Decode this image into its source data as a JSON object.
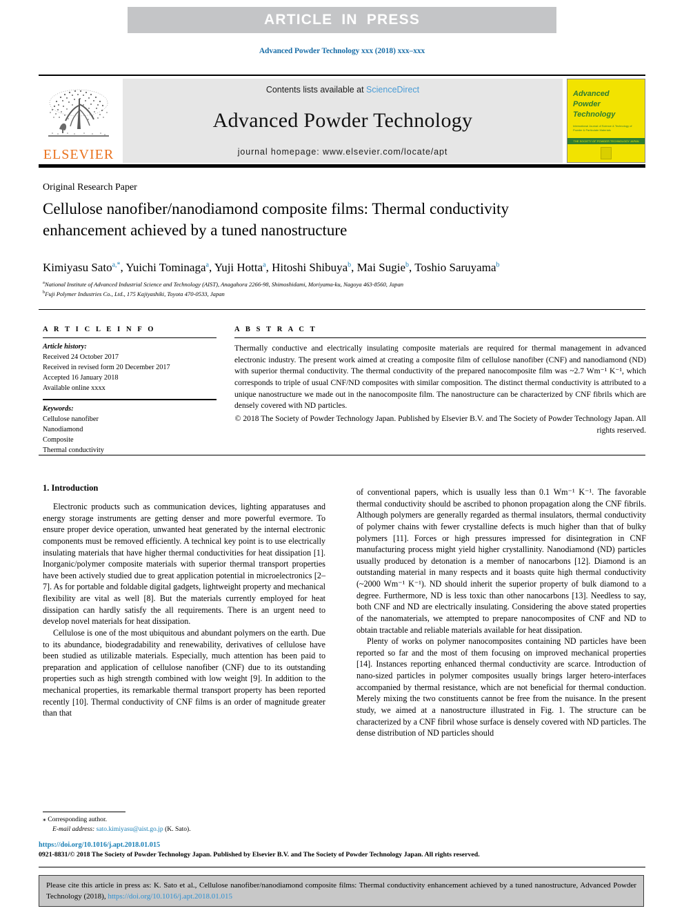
{
  "banner": {
    "text": "ARTICLE  IN  PRESS",
    "bg_color": "#c4c5c7",
    "text_color": "#ffffff"
  },
  "running_head": "Advanced Powder Technology xxx (2018) xxx–xxx",
  "masthead": {
    "publisher_logo_label": "ELSEVIER",
    "contents_prefix": "Contents lists available at ",
    "contents_link": "ScienceDirect",
    "journal_name": "Advanced Powder Technology",
    "homepage": "journal homepage: www.elsevier.com/locate/apt",
    "cover": {
      "line1": "Advanced",
      "line2": "Powder",
      "line3": "Technology",
      "subtitle": "International Journal of Science & Technology of Powder & Particulate Materials",
      "band_text": "THE SOCIETY OF POWDER TECHNOLOGY JAPAN",
      "bg_color": "#f2e300",
      "text_color": "#2e7d32"
    },
    "link_color": "#4a9cd6"
  },
  "article": {
    "type": "Original Research Paper",
    "title": "Cellulose nanofiber/nanodiamond composite films: Thermal conductivity enhancement achieved by a tuned nanostructure",
    "authors": [
      {
        "name": "Kimiyasu Sato",
        "marks": "a,*"
      },
      {
        "name": "Yuichi Tominaga",
        "marks": "a"
      },
      {
        "name": "Yuji Hotta",
        "marks": "a"
      },
      {
        "name": "Hitoshi Shibuya",
        "marks": "b"
      },
      {
        "name": "Mai Sugie",
        "marks": "b"
      },
      {
        "name": "Toshio Saruyama",
        "marks": "b"
      }
    ],
    "affiliations": [
      {
        "mark": "a",
        "text": "National Institute of Advanced Industrial Science and Technology (AIST), Anagahora 2266-98, Shimoshidami, Moriyama-ku, Nagoya 463-8560, Japan"
      },
      {
        "mark": "b",
        "text": "Fuji Polymer Industries Co., Ltd., 175 Kajiyashiki, Toyota 470-0533, Japan"
      }
    ]
  },
  "article_info": {
    "heading": "A R T I C L E   I N F O",
    "history_label": "Article history:",
    "history": [
      "Received 24 October 2017",
      "Received in revised form 20 December 2017",
      "Accepted 16 January 2018",
      "Available online xxxx"
    ],
    "keywords_label": "Keywords:",
    "keywords": [
      "Cellulose nanofiber",
      "Nanodiamond",
      "Composite",
      "Thermal conductivity"
    ]
  },
  "abstract": {
    "heading": "A B S T R A C T",
    "body": "Thermally conductive and electrically insulating composite materials are required for thermal management in advanced electronic industry. The present work aimed at creating a composite film of cellulose nanofiber (CNF) and nanodiamond (ND) with superior thermal conductivity. The thermal conductivity of the prepared nanocomposite film was ~2.7 Wm⁻¹ K⁻¹, which corresponds to triple of usual CNF/ND composites with similar composition. The distinct thermal conductivity is attributed to a unique nanostructure we made out in the nanocomposite film. The nanostructure can be characterized by CNF fibrils which are densely covered with ND particles.",
    "copyright": "© 2018 The Society of Powder Technology Japan. Published by Elsevier B.V. and The Society of Powder Technology Japan. All rights reserved."
  },
  "body": {
    "section_heading": "1. Introduction",
    "left_paragraphs": [
      "Electronic products such as communication devices, lighting apparatuses and energy storage instruments are getting denser and more powerful evermore. To ensure proper device operation, unwanted heat generated by the internal electronic components must be removed efficiently. A technical key point is to use electrically insulating materials that have higher thermal conductivities for heat dissipation [1]. Inorganic/polymer composite materials with superior thermal transport properties have been actively studied due to great application potential in microelectronics [2–7]. As for portable and foldable digital gadgets, lightweight property and mechanical flexibility are vital as well [8]. But the materials currently employed for heat dissipation can hardly satisfy the all requirements. There is an urgent need to develop novel materials for heat dissipation.",
      "Cellulose is one of the most ubiquitous and abundant polymers on the earth. Due to its abundance, biodegradability and renewability, derivatives of cellulose have been studied as utilizable materials. Especially, much attention has been paid to preparation and application of cellulose nanofiber (CNF) due to its outstanding properties such as high strength combined with low weight [9]. In addition to the mechanical properties, its remarkable thermal transport property has been reported recently [10]. Thermal conductivity of CNF films is an order of magnitude greater than that"
    ],
    "right_paragraphs": [
      "of conventional papers, which is usually less than 0.1 Wm⁻¹ K⁻¹. The favorable thermal conductivity should be ascribed to phonon propagation along the CNF fibrils. Although polymers are generally regarded as thermal insulators, thermal conductivity of polymer chains with fewer crystalline defects is much higher than that of bulky polymers [11]. Forces or high pressures impressed for disintegration in CNF manufacturing process might yield higher crystallinity. Nanodiamond (ND) particles usually produced by detonation is a member of nanocarbons [12]. Diamond is an outstanding material in many respects and it boasts quite high thermal conductivity (~2000 Wm⁻¹ K⁻¹). ND should inherit the superior property of bulk diamond to a degree. Furthermore, ND is less toxic than other nanocarbons [13]. Needless to say, both CNF and ND are electrically insulating. Considering the above stated properties of the nanomaterials, we attempted to prepare nanocomposites of CNF and ND to obtain tractable and reliable materials available for heat dissipation.",
      "Plenty of works on polymer nanocomposites containing ND particles have been reported so far and the most of them focusing on improved mechanical properties [14]. Instances reporting enhanced thermal conductivity are scarce. Introduction of nano-sized particles in polymer composites usually brings larger hetero-interfaces accompanied by thermal resistance, which are not beneficial for thermal conduction. Merely mixing the two constituents cannot be free from the nuisance. In the present study, we aimed at a nanostructure illustrated in Fig. 1. The structure can be characterized by a CNF fibril whose surface is densely covered with ND particles. The dense distribution of ND particles should"
    ]
  },
  "footnote": {
    "corresponding_marker": "⁎",
    "corresponding_label": "Corresponding author.",
    "email_label": "E-mail address:",
    "email": "sato.kimiyasu@aist.go.jp",
    "email_owner": "(K. Sato)."
  },
  "footer": {
    "doi": "https://doi.org/10.1016/j.apt.2018.01.015",
    "copyright": "0921-8831/© 2018 The Society of Powder Technology Japan. Published by Elsevier B.V. and The Society of Powder Technology Japan. All rights reserved."
  },
  "cite_box": {
    "text": "Please cite this article in press as: K. Sato et al., Cellulose nanofiber/nanodiamond composite films: Thermal conductivity enhancement achieved by a tuned nanostructure, Advanced Powder Technology (2018), ",
    "link": "https://doi.org/10.1016/j.apt.2018.01.015",
    "bg_color": "#c8c8c8"
  },
  "colors": {
    "link_blue": "#1a7fb5",
    "elsevier_orange": "#E9711C",
    "banner_gray": "#c4c5c7",
    "masthead_gray": "#e6e6e6"
  }
}
